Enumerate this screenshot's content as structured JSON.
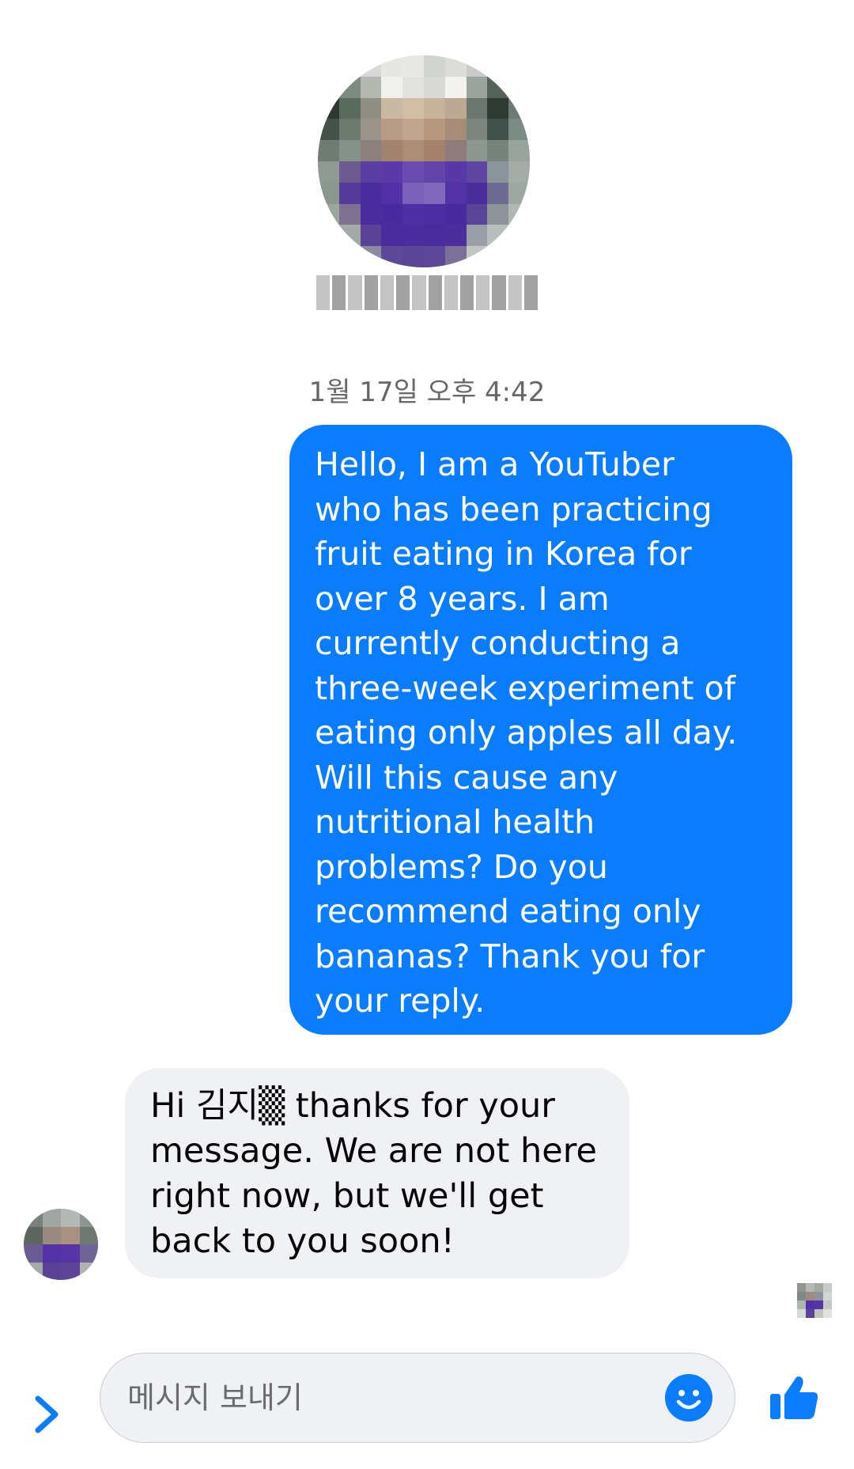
{
  "profile": {
    "avatar_alt": "pixelated profile photo",
    "name_redacted": true
  },
  "conversation": {
    "timestamp": "1월 17일 오후 4:42",
    "messages": [
      {
        "from": "me",
        "text": "Hello, I am a YouTuber\nwho has been practicing\nfruit eating in Korea for\nover 8 years.  I am\ncurrently conducting a\nthree-week experiment of\neating only apples all day.\nWill this cause any\nnutritional health\nproblems?  Do you\nrecommend eating only\nbananas?  Thank you for\nyour reply."
      },
      {
        "from": "them",
        "text": "Hi 김지▒ thanks for your\nmessage. We are not here\nright now, but we'll get\nback to you soon!"
      }
    ]
  },
  "composer": {
    "placeholder": "메시지 보내기",
    "expand_icon": "chevron-right-icon",
    "emoji_icon": "smiley-icon",
    "like_icon": "thumbs-up-icon"
  },
  "colors": {
    "accent": "#0a7cff",
    "sent_bubble": "#0a7cff",
    "received_bubble": "#f0f1f5",
    "timestamp_text": "#65676b"
  }
}
